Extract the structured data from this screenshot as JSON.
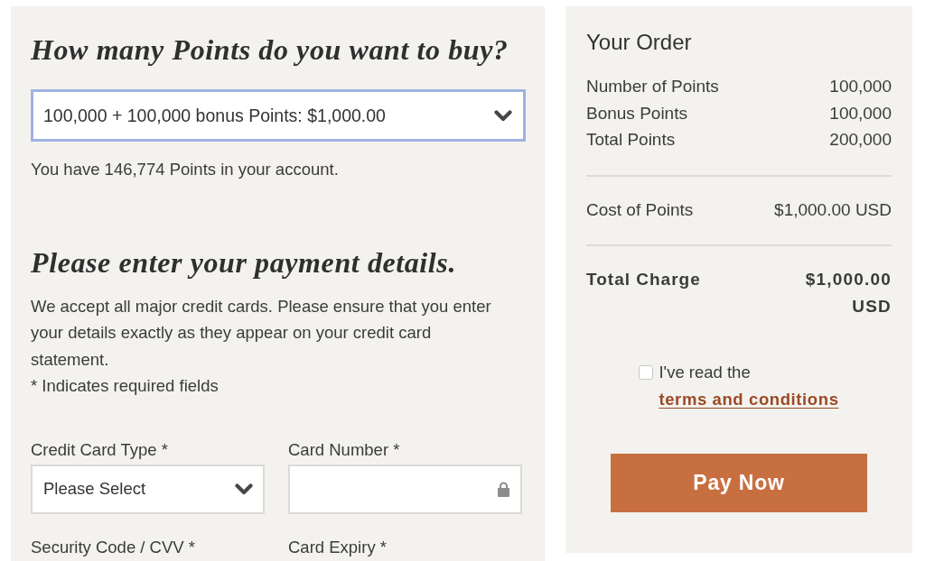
{
  "points_section": {
    "heading": "How many Points do you want to buy?",
    "points_select": {
      "value": "100,000 + 100,000 bonus Points: $1,000.00",
      "focused": true
    },
    "balance_note": "You have 146,774 Points in your account."
  },
  "payment_section": {
    "heading": "Please enter your payment details.",
    "intro": "We accept all major credit cards. Please ensure that you enter your details exactly as they appear on your credit card statement.",
    "required_note": "* Indicates required fields",
    "fields": [
      {
        "label": "Credit Card Type *",
        "control": {
          "kind": "select",
          "value": "Please Select"
        }
      },
      {
        "label": "Card Number *",
        "control": {
          "kind": "secure_input"
        }
      },
      {
        "label": "Security Code / CVV *"
      },
      {
        "label": "Card Expiry *"
      }
    ]
  },
  "order": {
    "title": "Your Order",
    "groups": [
      {
        "emphasis": false,
        "rows": [
          {
            "label": "Number of Points",
            "value": "100,000"
          },
          {
            "label": "Bonus Points",
            "value": "100,000"
          },
          {
            "label": "Total Points",
            "value": "200,000"
          }
        ]
      },
      {
        "emphasis": false,
        "rows": [
          {
            "label": "Cost of Points",
            "value": "$1,000.00 USD"
          }
        ]
      },
      {
        "emphasis": true,
        "rows": [
          {
            "label": "Total Charge",
            "value": "$1,000.00 USD"
          }
        ]
      }
    ],
    "terms": {
      "checked": false,
      "text": "I've read the",
      "link": "terms and conditions"
    },
    "pay_button": "Pay Now"
  }
}
